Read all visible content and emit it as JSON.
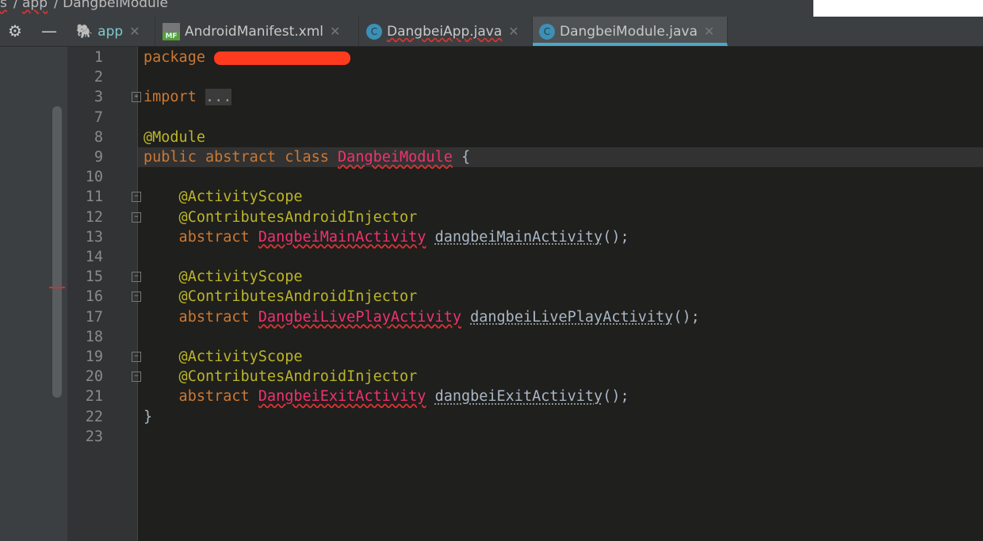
{
  "breadcrumb": [
    "s",
    "app",
    "DangbeiModule"
  ],
  "tabs": [
    {
      "label": "app",
      "icon": "gradle-elephant-icon"
    },
    {
      "label": "AndroidManifest.xml",
      "icon": "manifest-icon",
      "badge": "MF"
    },
    {
      "label": "DangbeiApp.java",
      "icon": "class-icon",
      "badge": "C"
    },
    {
      "label": "DangbeiModule.java",
      "icon": "class-icon",
      "badge": "C",
      "active": true
    }
  ],
  "colors": {
    "keyword": "#cc7832",
    "annotation": "#bbb529",
    "class": "#f0326e",
    "accent": "#4aa8c8"
  },
  "lines": [
    {
      "n": "1",
      "kw": "package",
      "redacted": true
    },
    {
      "n": "2"
    },
    {
      "n": "3",
      "kw": "import",
      "extra": "..."
    },
    {
      "n": "7"
    },
    {
      "n": "8",
      "an": "@Module"
    },
    {
      "n": "9",
      "kw": "public abstract class",
      "cl": "DangbeiModule",
      "tail": " {"
    },
    {
      "n": "10"
    },
    {
      "n": "11",
      "an": "    @ActivityScope"
    },
    {
      "n": "12",
      "an": "    @ContributesAndroidInjector"
    },
    {
      "n": "13",
      "kw": "    abstract",
      "cl": "DangbeiMainActivity",
      "me": "dangbeiMainActivity",
      "tail": "();"
    },
    {
      "n": "14"
    },
    {
      "n": "15",
      "an": "    @ActivityScope"
    },
    {
      "n": "16",
      "an": "    @ContributesAndroidInjector"
    },
    {
      "n": "17",
      "kw": "    abstract",
      "cl": "DangbeiLivePlayActivity",
      "me": "dangbeiLivePlayActivity",
      "tail": "();"
    },
    {
      "n": "18"
    },
    {
      "n": "19",
      "an": "    @ActivityScope"
    },
    {
      "n": "20",
      "an": "    @ContributesAndroidInjector"
    },
    {
      "n": "21",
      "kw": "    abstract",
      "cl": "DangbeiExitActivity",
      "me": "dangbeiExitActivity",
      "tail": "();"
    },
    {
      "n": "22",
      "tail": "}"
    },
    {
      "n": "23"
    }
  ]
}
